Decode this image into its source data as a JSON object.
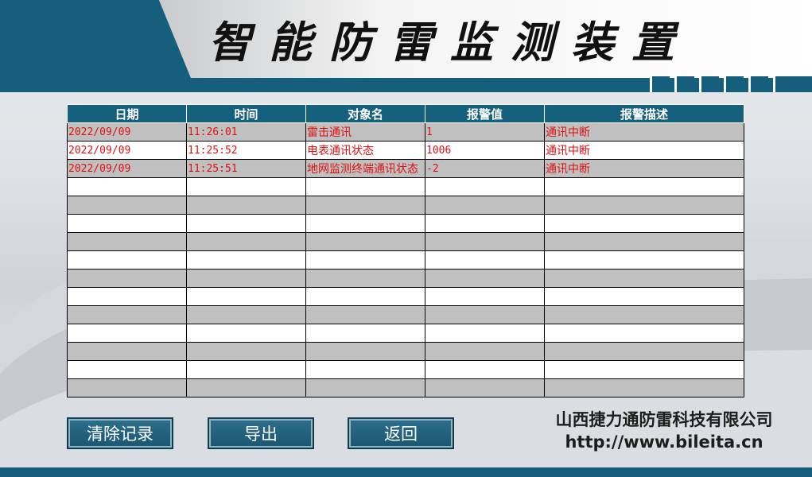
{
  "app": {
    "title": "智能防雷监测装置"
  },
  "table": {
    "columns": [
      "日期",
      "时间",
      "对象名",
      "报警值",
      "报警描述"
    ],
    "rows": [
      [
        "2022/09/09",
        "11:26:01",
        "雷击通讯",
        "1",
        "通讯中断"
      ],
      [
        "2022/09/09",
        "11:25:52",
        "电表通讯状态",
        "1006",
        "通讯中断"
      ],
      [
        "2022/09/09",
        "11:25:51",
        "地网监测终端通讯状态",
        "-2",
        "通讯中断"
      ],
      [
        "",
        "",
        "",
        "",
        ""
      ],
      [
        "",
        "",
        "",
        "",
        ""
      ],
      [
        "",
        "",
        "",
        "",
        ""
      ],
      [
        "",
        "",
        "",
        "",
        ""
      ],
      [
        "",
        "",
        "",
        "",
        ""
      ],
      [
        "",
        "",
        "",
        "",
        ""
      ],
      [
        "",
        "",
        "",
        "",
        ""
      ],
      [
        "",
        "",
        "",
        "",
        ""
      ],
      [
        "",
        "",
        "",
        "",
        ""
      ],
      [
        "",
        "",
        "",
        "",
        ""
      ],
      [
        "",
        "",
        "",
        "",
        ""
      ],
      [
        "",
        "",
        "",
        "",
        ""
      ]
    ]
  },
  "buttons": {
    "clear": "清除记录",
    "export": "导出",
    "back": "返回"
  },
  "company": {
    "name": "山西捷力通防雷科技有限公司",
    "url": "http://www.bileita.cn"
  },
  "colors": {
    "header": "#155f7c",
    "alarm_text": "#e01010",
    "row_alt": "#c0c0c0"
  }
}
